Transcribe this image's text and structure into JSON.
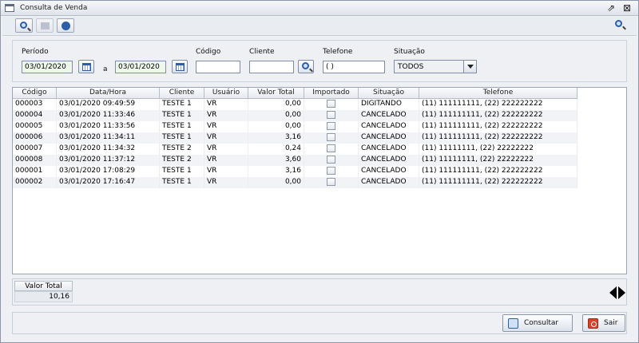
{
  "window": {
    "title": "Consulta de Venda"
  },
  "filters": {
    "periodo_label": "Período",
    "date_from": "03/01/2020",
    "a_label": "a",
    "date_to": "03/01/2020",
    "codigo_label": "Código",
    "codigo_value": "",
    "cliente_label": "Cliente",
    "cliente_value": "",
    "telefone_label": "Telefone",
    "telefone_value": "( )",
    "situacao_label": "Situação",
    "situacao_value": "TODOS"
  },
  "grid": {
    "columns": [
      "Código",
      "Data/Hora",
      "Cliente",
      "Usuário",
      "Valor Total",
      "Importado",
      "Situação",
      "Telefone"
    ],
    "rows": [
      [
        "000003",
        "03/01/2020 09:49:59",
        "TESTE 1",
        "VR",
        "0,00",
        "",
        "DIGITANDO",
        "(11) 111111111, (22) 222222222"
      ],
      [
        "000004",
        "03/01/2020 11:33:46",
        "TESTE 1",
        "VR",
        "0,00",
        "",
        "CANCELADO",
        "(11) 111111111, (22) 222222222"
      ],
      [
        "000005",
        "03/01/2020 11:33:56",
        "TESTE 1",
        "VR",
        "0,00",
        "",
        "CANCELADO",
        "(11) 111111111, (22) 222222222"
      ],
      [
        "000006",
        "03/01/2020 11:34:11",
        "TESTE 1",
        "VR",
        "3,16",
        "",
        "CANCELADO",
        "(11) 111111111, (22) 222222222"
      ],
      [
        "000007",
        "03/01/2020 11:34:32",
        "TESTE 2",
        "VR",
        "0,24",
        "",
        "CANCELADO",
        "(11) 11111111, (22) 22222222"
      ],
      [
        "000008",
        "03/01/2020 11:37:12",
        "TESTE 2",
        "VR",
        "3,60",
        "",
        "CANCELADO",
        "(11) 11111111, (22) 22222222"
      ],
      [
        "000001",
        "03/01/2020 17:08:29",
        "TESTE 1",
        "VR",
        "3,16",
        "",
        "CANCELADO",
        "(11) 111111111, (22) 222222222"
      ],
      [
        "000002",
        "03/01/2020 17:16:47",
        "TESTE 1",
        "VR",
        "0,00",
        "",
        "CANCELADO",
        "(11) 111111111, (22) 222222222"
      ]
    ]
  },
  "totals": {
    "header": "Valor Total",
    "value": "10,16"
  },
  "actions": {
    "consultar": "Consultar",
    "sair": "Sair"
  }
}
